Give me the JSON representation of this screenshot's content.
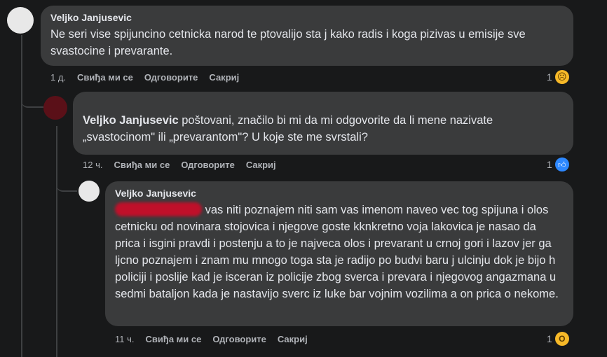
{
  "comments": [
    {
      "author": "Veljko Janjusevic",
      "text": "Ne seri vise spijuncino cetnicka narod te ptovalijo sta j kako radis i koga pizivas u emisije sve svastocine i prevarante.",
      "time": "1 д.",
      "like": "Свиђа ми се",
      "reply": "Одговорите",
      "hide": "Сакриј",
      "reaction_count": "1",
      "reaction": "sad-emoji"
    },
    {
      "author": "",
      "mention": "Veljko Janjusevic",
      "text": " poštovani, značilo bi mi da mi odgovorite da li mene nazivate „svastocinom\" ili „prevarantom\"? U koje ste me svrstali?",
      "time": "12 ч.",
      "like": "Свиђа ми се",
      "reply": "Одговорите",
      "hide": "Сакриј",
      "reaction_count": "1",
      "reaction": "like-icon"
    },
    {
      "author": "Veljko Janjusevic",
      "text": " vas niti poznajem niti sam vas imenom naveo vec tog spijuna i olos cetnicku od novinara stojovica i njegove goste kknkretno voja lakovica je nasao da prica i isgini pravdi i postenju a to je najveca olos i prevarant u crnoj gori i lazov jer ga ljcno poznajem i znam mu mnogo toga sta je radijo po budvi baru j ulcinju dok je bijo h policiji i poslije kad je isceran iz policije zbog sverca i prevara i njegovog angazmana u sedmi bataljon kada je nastavijo sverc iz luke bar vojnim vozilima a on prica o nekome.",
      "time": "11 ч.",
      "like": "Свиђа ми се",
      "reply": "Одговорите",
      "hide": "Сакриј",
      "reaction_count": "1",
      "reaction": "wow-emoji"
    }
  ],
  "colors": {
    "background": "#18191a",
    "bubble": "#3a3b3c",
    "text": "#e4e6eb",
    "secondary": "#b0b3b8",
    "like_blue": "#2d88ff",
    "redaction": "#c0102a"
  }
}
